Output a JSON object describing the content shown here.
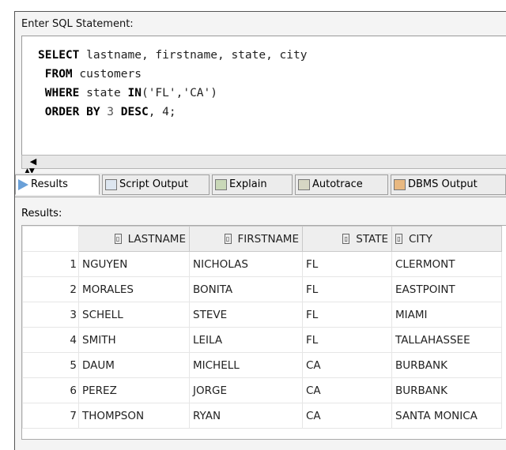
{
  "editor": {
    "label": "Enter SQL Statement:",
    "sql": {
      "select_kw": "SELECT",
      "select_cols": " lastname, firstname, state, city",
      "from_kw": "FROM",
      "from_table": " customers",
      "where_kw": "WHERE",
      "where_mid": " state ",
      "in_kw": "IN",
      "where_vals": "('FL','CA')",
      "order_kw": "ORDER BY",
      "order_num1": " 3 ",
      "desc_kw": "DESC",
      "order_rest": ", 4;"
    }
  },
  "tabs": [
    {
      "label": "Results",
      "icon": "results-icon",
      "active": true
    },
    {
      "label": "Script Output",
      "icon": "script-output-icon"
    },
    {
      "label": "Explain",
      "icon": "explain-icon"
    },
    {
      "label": "Autotrace",
      "icon": "autotrace-icon"
    },
    {
      "label": "DBMS Output",
      "icon": "dbms-output-icon"
    }
  ],
  "results": {
    "label": "Results:",
    "columns": [
      "LASTNAME",
      "FIRSTNAME",
      "STATE",
      "CITY"
    ],
    "rows": [
      {
        "n": "1",
        "cells": [
          "NGUYEN",
          "NICHOLAS",
          "FL",
          "CLERMONT"
        ]
      },
      {
        "n": "2",
        "cells": [
          "MORALES",
          "BONITA",
          "FL",
          "EASTPOINT"
        ]
      },
      {
        "n": "3",
        "cells": [
          "SCHELL",
          "STEVE",
          "FL",
          "MIAMI"
        ]
      },
      {
        "n": "4",
        "cells": [
          "SMITH",
          "LEILA",
          "FL",
          "TALLAHASSEE"
        ]
      },
      {
        "n": "5",
        "cells": [
          "DAUM",
          "MICHELL",
          "CA",
          "BURBANK"
        ]
      },
      {
        "n": "6",
        "cells": [
          "PEREZ",
          "JORGE",
          "CA",
          "BURBANK"
        ]
      },
      {
        "n": "7",
        "cells": [
          "THOMPSON",
          "RYAN",
          "CA",
          "SANTA MONICA"
        ]
      }
    ]
  }
}
